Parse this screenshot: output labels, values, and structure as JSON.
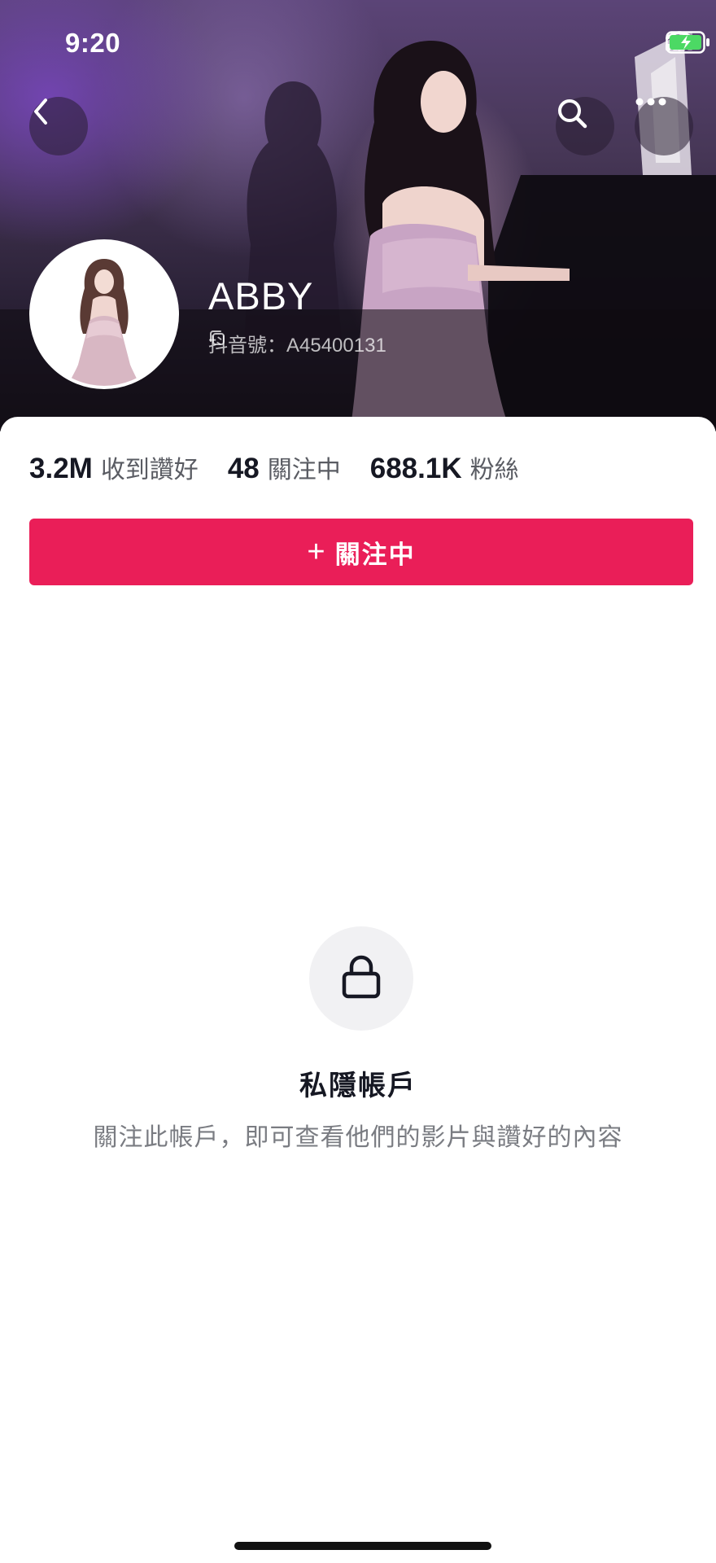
{
  "status_bar": {
    "time": "9:20",
    "icons": [
      "signal-icon",
      "wifi-icon",
      "battery-charging-icon"
    ]
  },
  "header": {
    "back_icon": "chevron-left-icon",
    "search_icon": "search-icon",
    "more_icon": "more-horizontal-icon"
  },
  "profile": {
    "name": "ABBY",
    "id_text": "抖音號：A45400131",
    "copy_icon": "copy-icon"
  },
  "stats": [
    {
      "value": "3.2M",
      "label": "收到讚好"
    },
    {
      "value": "48",
      "label": "關注中"
    },
    {
      "value": "688.1K",
      "label": "粉絲"
    }
  ],
  "follow_button": {
    "plus": "+",
    "label": "關注中",
    "color": "#ea1e58"
  },
  "private_account": {
    "icon": "lock-icon",
    "title": "私隱帳戶",
    "description": "關注此帳戶，即可查看他們的影片與讚好的內容"
  }
}
